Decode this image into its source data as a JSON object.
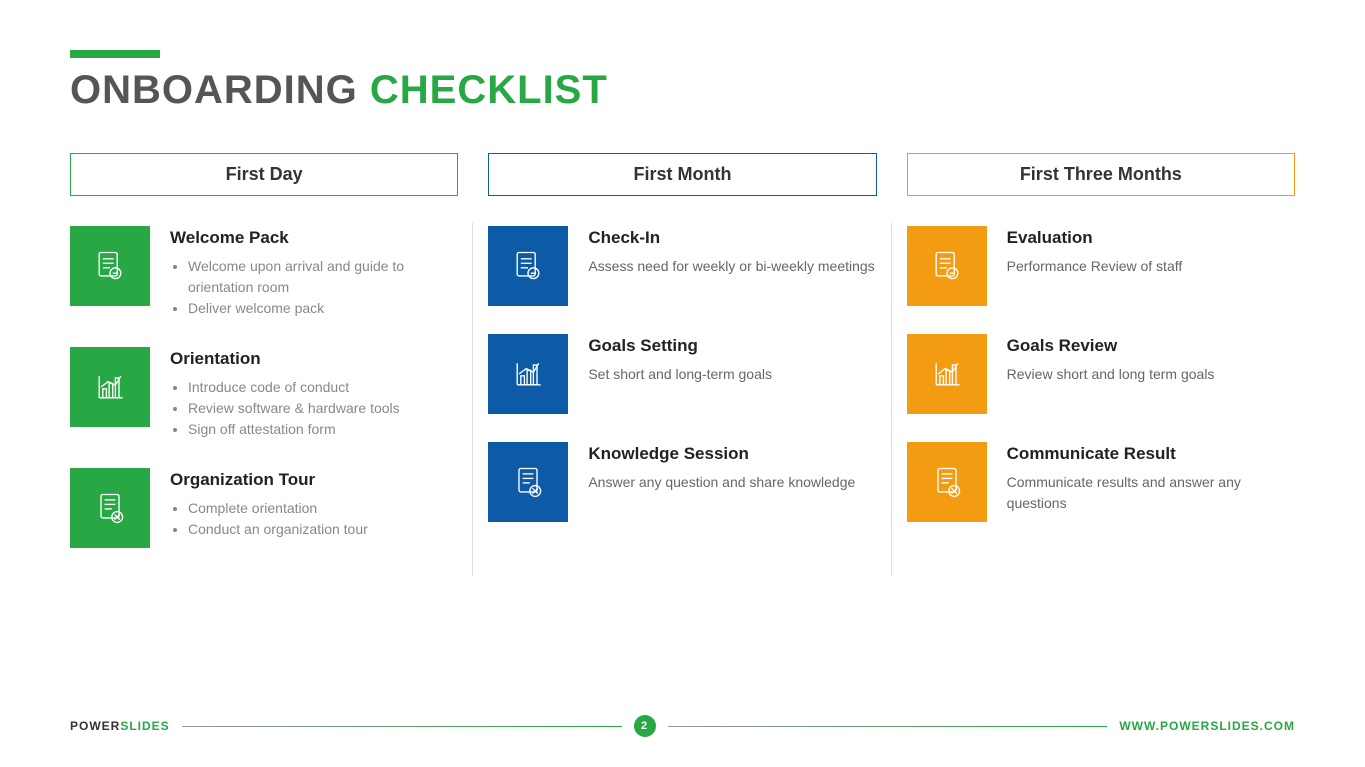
{
  "title": {
    "word1": "ONBOARDING",
    "word2": "CHECKLIST"
  },
  "columns": [
    {
      "header": "First Day",
      "items": [
        {
          "icon": "doc",
          "title": "Welcome Pack",
          "bullets": [
            "Welcome upon arrival and guide to orientation room",
            "Deliver welcome pack"
          ]
        },
        {
          "icon": "chart",
          "title": "Orientation",
          "bullets": [
            "Introduce code of conduct",
            "Review software & hardware tools",
            "Sign off attestation form"
          ]
        },
        {
          "icon": "docx",
          "title": "Organization Tour",
          "bullets": [
            "Complete orientation",
            "Conduct an organization tour"
          ]
        }
      ]
    },
    {
      "header": "First Month",
      "items": [
        {
          "icon": "doc",
          "title": "Check-In",
          "desc": "Assess need for weekly or bi-weekly meetings"
        },
        {
          "icon": "chart",
          "title": "Goals Setting",
          "desc": "Set short and long-term goals"
        },
        {
          "icon": "docx",
          "title": "Knowledge Session",
          "desc": "Answer any question and share knowledge"
        }
      ]
    },
    {
      "header": "First Three Months",
      "items": [
        {
          "icon": "doc",
          "title": "Evaluation",
          "desc": "Performance Review of staff"
        },
        {
          "icon": "chart",
          "title": "Goals Review",
          "desc": "Review short and long term goals"
        },
        {
          "icon": "docx",
          "title": "Communicate Result",
          "desc": "Communicate results and answer any questions"
        }
      ]
    }
  ],
  "footer": {
    "brand1": "POWER",
    "brand2": "SLIDES",
    "page": "2",
    "url": "WWW.POWERSLIDES.COM"
  }
}
